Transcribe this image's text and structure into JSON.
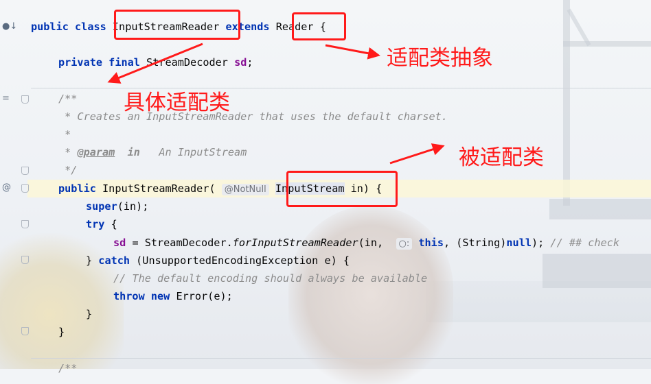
{
  "editor": {
    "line1": {
      "kw_public": "public",
      "kw_class": "class",
      "class_name": "InputStreamReader",
      "kw_extends": "extends",
      "super_name": "Reader",
      "brace": "{"
    },
    "line2": {
      "kw_private": "private",
      "kw_final": "final",
      "type": "StreamDecoder",
      "field": "sd",
      "semi": ";"
    },
    "doc": {
      "open": "/**",
      "desc": " * Creates an InputStreamReader that uses the default charset.",
      "star": " *",
      "param_prefix": " * ",
      "param_tag": "@param",
      "param_name": "in",
      "param_desc": "   An InputStream",
      "close": " */"
    },
    "ctor": {
      "kw_public": "public",
      "name": "InputStreamReader(",
      "hint": "@NotNull",
      "param_type": "InputStream",
      "param_name": " in)",
      "brace": " {"
    },
    "super_line": {
      "kw_super": "super",
      "rest": "(in);"
    },
    "try_line": {
      "kw_try": "try",
      "brace": " {"
    },
    "assign": {
      "field": "sd",
      "eq": " = StreamDecoder.",
      "method": "forInputStreamReader",
      "args1": "(in, ",
      "hint": "○:",
      "kw_this": "this",
      "args2": ", (String)",
      "kw_null": "null",
      "args3": "); ",
      "comment": "// ## check"
    },
    "catch_line": {
      "close": "} ",
      "kw_catch": "catch",
      "rest": " (UnsupportedEncodingException e) {"
    },
    "comment_line": "// The default encoding should always be available",
    "throw_line": {
      "kw_throw": "throw",
      "kw_new": "new",
      "rest": " Error(e);"
    },
    "close_inner": "}",
    "close_ctor": "}",
    "doc2_open": "/**"
  },
  "annotations": {
    "adapter_abstract": "适配类抽象",
    "concrete_adapter": "具体适配类",
    "adaptee": "被适配类"
  },
  "colors": {
    "annotation": "#ff1a1a",
    "keyword": "#0033b3",
    "field": "#871094",
    "comment": "#8c8c8c"
  }
}
